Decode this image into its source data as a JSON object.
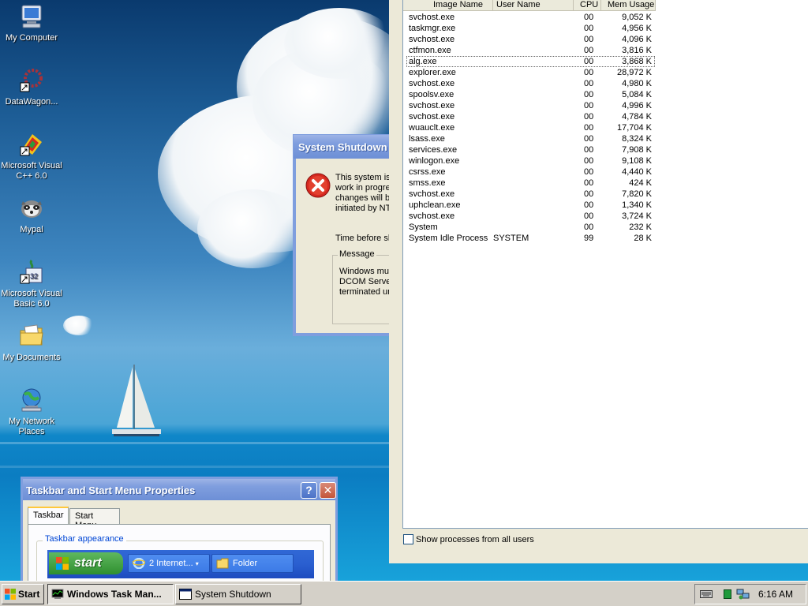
{
  "desktop_icons": [
    {
      "label": "My Computer",
      "icon": "my-computer-icon"
    },
    {
      "label": "DataWagon...",
      "icon": "datawagon-shortcut-icon"
    },
    {
      "label": "Microsoft Visual C++ 6.0",
      "icon": "visual-cpp-shortcut-icon"
    },
    {
      "label": "Mypal",
      "icon": "mypal-raccoon-icon"
    },
    {
      "label": "Microsoft Visual Basic 6.0",
      "icon": "visual-basic-shortcut-icon"
    },
    {
      "label": "My Documents",
      "icon": "my-documents-folder-icon"
    },
    {
      "label": "My Network Places",
      "icon": "my-network-places-icon"
    }
  ],
  "shutdown_dialog": {
    "title": "System Shutdown",
    "message_lines": [
      "This system is",
      "work in progre",
      "changes will b",
      "initiated by NT"
    ],
    "time_label": "Time before sh",
    "message_group_label": "Message",
    "message_group_lines": [
      "Windows mus",
      "DCOM Serve",
      "terminated un"
    ]
  },
  "task_manager": {
    "columns": [
      "Image Name",
      "User Name",
      "CPU",
      "Mem Usage"
    ],
    "processes": [
      {
        "name": "svchost.exe",
        "user": "",
        "cpu": "00",
        "mem": "9,052 K"
      },
      {
        "name": "taskmgr.exe",
        "user": "",
        "cpu": "00",
        "mem": "4,956 K"
      },
      {
        "name": "svchost.exe",
        "user": "",
        "cpu": "00",
        "mem": "4,096 K"
      },
      {
        "name": "ctfmon.exe",
        "user": "",
        "cpu": "00",
        "mem": "3,816 K"
      },
      {
        "name": "alg.exe",
        "user": "",
        "cpu": "00",
        "mem": "3,868 K"
      },
      {
        "name": "explorer.exe",
        "user": "",
        "cpu": "00",
        "mem": "28,972 K"
      },
      {
        "name": "svchost.exe",
        "user": "",
        "cpu": "00",
        "mem": "4,980 K"
      },
      {
        "name": "spoolsv.exe",
        "user": "",
        "cpu": "00",
        "mem": "5,084 K"
      },
      {
        "name": "svchost.exe",
        "user": "",
        "cpu": "00",
        "mem": "4,996 K"
      },
      {
        "name": "svchost.exe",
        "user": "",
        "cpu": "00",
        "mem": "4,784 K"
      },
      {
        "name": "wuauclt.exe",
        "user": "",
        "cpu": "00",
        "mem": "17,704 K"
      },
      {
        "name": "lsass.exe",
        "user": "",
        "cpu": "00",
        "mem": "8,324 K"
      },
      {
        "name": "services.exe",
        "user": "",
        "cpu": "00",
        "mem": "7,908 K"
      },
      {
        "name": "winlogon.exe",
        "user": "",
        "cpu": "00",
        "mem": "9,108 K"
      },
      {
        "name": "csrss.exe",
        "user": "",
        "cpu": "00",
        "mem": "4,440 K"
      },
      {
        "name": "smss.exe",
        "user": "",
        "cpu": "00",
        "mem": "424 K"
      },
      {
        "name": "svchost.exe",
        "user": "",
        "cpu": "00",
        "mem": "7,820 K"
      },
      {
        "name": "uphclean.exe",
        "user": "",
        "cpu": "00",
        "mem": "1,340 K"
      },
      {
        "name": "svchost.exe",
        "user": "",
        "cpu": "00",
        "mem": "3,724 K"
      },
      {
        "name": "System",
        "user": "",
        "cpu": "00",
        "mem": "232 K"
      },
      {
        "name": "System Idle Process",
        "user": "SYSTEM",
        "cpu": "99",
        "mem": "28 K"
      }
    ],
    "selected_index": 4,
    "show_all_label": "Show processes from all users"
  },
  "taskbar_properties": {
    "title": "Taskbar and Start Menu Properties",
    "help_label": "?",
    "close_label": "✕",
    "tabs": [
      "Taskbar",
      "Start Menu"
    ],
    "active_tab": "Taskbar",
    "group_label": "Taskbar appearance",
    "preview": {
      "start_label": "start",
      "button1_label": "2 Internet...",
      "button2_label": "Folder"
    }
  },
  "taskbar": {
    "start_label": "Start",
    "buttons": [
      {
        "label": "Windows Task Man...",
        "pressed": true
      },
      {
        "label": "System Shutdown",
        "pressed": false
      }
    ],
    "clock": "6:16 AM"
  },
  "colors": {
    "xp_title_blue": "#7f9ede",
    "classic_gray": "#d4d0c8",
    "error_red": "#d6281f"
  }
}
